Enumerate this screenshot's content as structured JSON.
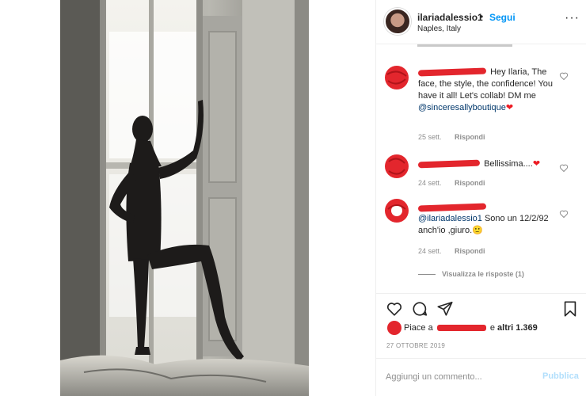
{
  "post": {
    "username": "ilariadalessio1",
    "follow_label": "Segui",
    "separator": "•",
    "location": "Naples, Italy",
    "more_label": "···"
  },
  "comments": [
    {
      "text": "Hey Ilaria, The face, the style, the confidence! You have it all! Let's collab! DM me",
      "mention": "@sinceresallyboutique",
      "emoji": "❤",
      "time": "25 sett.",
      "reply": "Rispondi"
    },
    {
      "text": "Bellissima....",
      "emoji": "❤",
      "time": "24 sett.",
      "reply": "Rispondi"
    },
    {
      "mention": "@ilariadalessio1",
      "text": "Sono un 12/2/92 anch'io ,giuro.",
      "emoji": "🙂",
      "time": "24 sett.",
      "reply": "Rispondi"
    }
  ],
  "view_replies": "Visualizza le risposte (1)",
  "likes": {
    "prefix": "Piace a",
    "middle": "e",
    "others": "altri 1.369"
  },
  "date": "27 OTTOBRE 2019",
  "add_comment": {
    "placeholder": "Aggiungi un commento...",
    "publish": "Pubblica"
  },
  "colors": {
    "link_blue": "#0095f6",
    "redaction_red": "#e3262d",
    "muted": "#8e8e8e"
  },
  "icons": [
    "heart-icon",
    "comment-icon",
    "share-icon",
    "bookmark-icon",
    "more-icon"
  ]
}
